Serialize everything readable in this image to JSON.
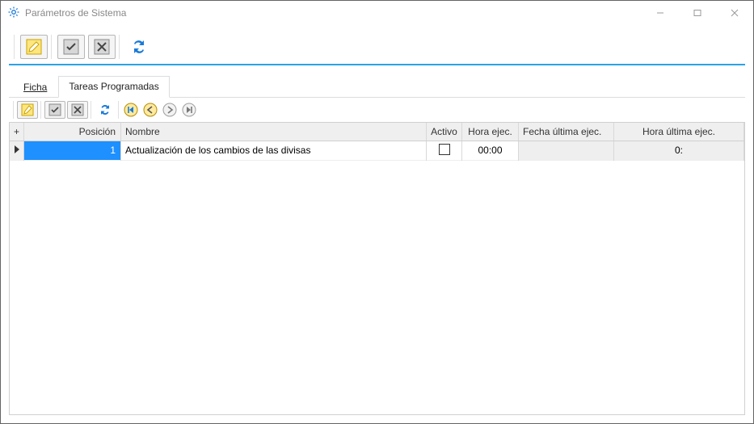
{
  "window": {
    "title": "Parámetros de Sistema"
  },
  "mainToolbar": {
    "edit": "edit",
    "confirm": "confirm",
    "cancel": "cancel",
    "refresh": "refresh"
  },
  "tabs": {
    "ficha": "Ficha",
    "tareas": "Tareas Programadas",
    "activeIndex": 1
  },
  "subToolbar": {
    "edit": "edit",
    "confirm": "confirm",
    "cancel": "cancel",
    "refresh": "refresh",
    "first": "first",
    "prev": "prev",
    "next": "next",
    "last": "last"
  },
  "grid": {
    "plus": "+",
    "headers": {
      "posicion": "Posición",
      "nombre": "Nombre",
      "activo": "Activo",
      "hora_ejec": "Hora ejec.",
      "fecha_ultima": "Fecha última ejec.",
      "hora_ultima": "Hora última ejec."
    },
    "rows": [
      {
        "posicion": "1",
        "nombre": "Actualización de los cambios de las divisas",
        "activo": false,
        "hora_ejec": "00:00",
        "fecha_ultima": "",
        "hora_ultima": "0:"
      }
    ]
  }
}
